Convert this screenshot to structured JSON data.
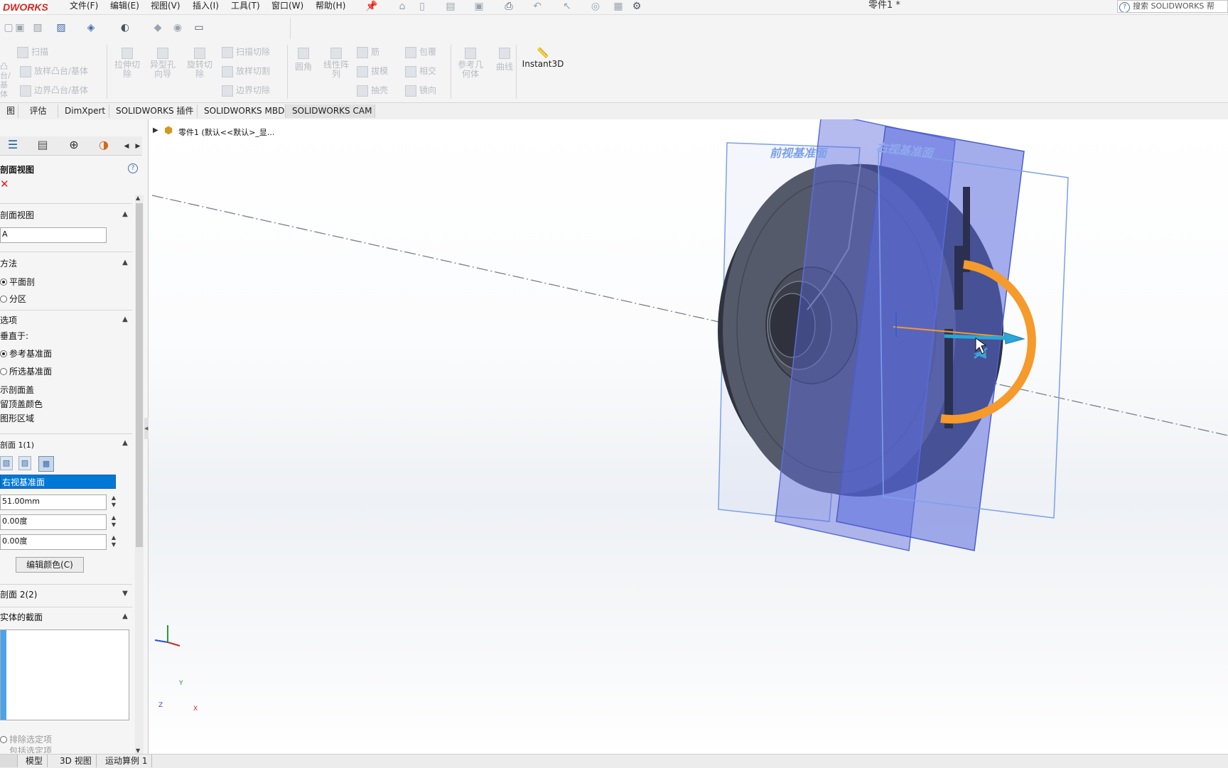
{
  "app": {
    "logo_text": "DWORKS",
    "document_title": "零件1 *",
    "search_label": "搜索 SOLIDWORKS 帮"
  },
  "menu": [
    "文件(F)",
    "编辑(E)",
    "视图(V)",
    "插入(I)",
    "工具(T)",
    "窗口(W)",
    "帮助(H)"
  ],
  "command_manager": {
    "group1": [
      "扫描",
      "放样凸台/基体",
      "边界凸台/基体"
    ],
    "boss_label": "凸台/基体",
    "extrude_cut": "拉伸切除",
    "hole_wizard": "异型孔向导",
    "revolve_cut": "旋转切除",
    "group2": [
      "扫描切除",
      "放样切割",
      "边界切除"
    ],
    "fillet": "圆角",
    "linear_pattern": "线性阵列",
    "group3": [
      "筋",
      "拔模",
      "抽壳"
    ],
    "group4": [
      "包覆",
      "相交",
      "镜向"
    ],
    "ref_geometry": "参考几何体",
    "curves": "曲线",
    "instant3d": "Instant3D"
  },
  "tabs": [
    "图",
    "评估",
    "DimXpert",
    "SOLIDWORKS 插件",
    "SOLIDWORKS MBD",
    "SOLIDWORKS CAM"
  ],
  "tree": {
    "breadcrumb": "零件1  (默认<<默认>_显..."
  },
  "panel": {
    "title": "剖面视图",
    "section_view_header": "剖面视图",
    "section_name": "A",
    "method_header": "方法",
    "method_options": [
      "平面剖",
      "分区"
    ],
    "options_header": "选项",
    "perpendicular_label": "垂直于:",
    "perpendicular_options": [
      "参考基准面",
      "所选基准面"
    ],
    "checkbox_items": [
      "示剖面盖",
      "留顶盖颜色",
      "图形区域"
    ],
    "section1_header": "剖面 1(1)",
    "selected_plane": "右视基准面",
    "offset": "51.00mm",
    "angle1": "0.00度",
    "angle2": "0.00度",
    "edit_color": "编辑颜色(C)",
    "section2_header": "剖面 2(2)",
    "bodies_header": "实体的截面",
    "exclude_option": "排除选定项",
    "include_option": "包括选定项"
  },
  "viewport": {
    "front_plane": "前视基准面",
    "right_plane": "右视基准面",
    "triad_y": "Y",
    "triad_z": "Z",
    "triad_x": "X"
  },
  "status_tabs": [
    "模型",
    "3D 视图",
    "运动算例 1"
  ],
  "colors": {
    "accent_red": "#d8251f",
    "selection_blue": "#0078d7",
    "plane_blue": "#6f7fd9",
    "drag_orange": "#f59a2b",
    "arrow_cyan": "#2aa6d8"
  }
}
